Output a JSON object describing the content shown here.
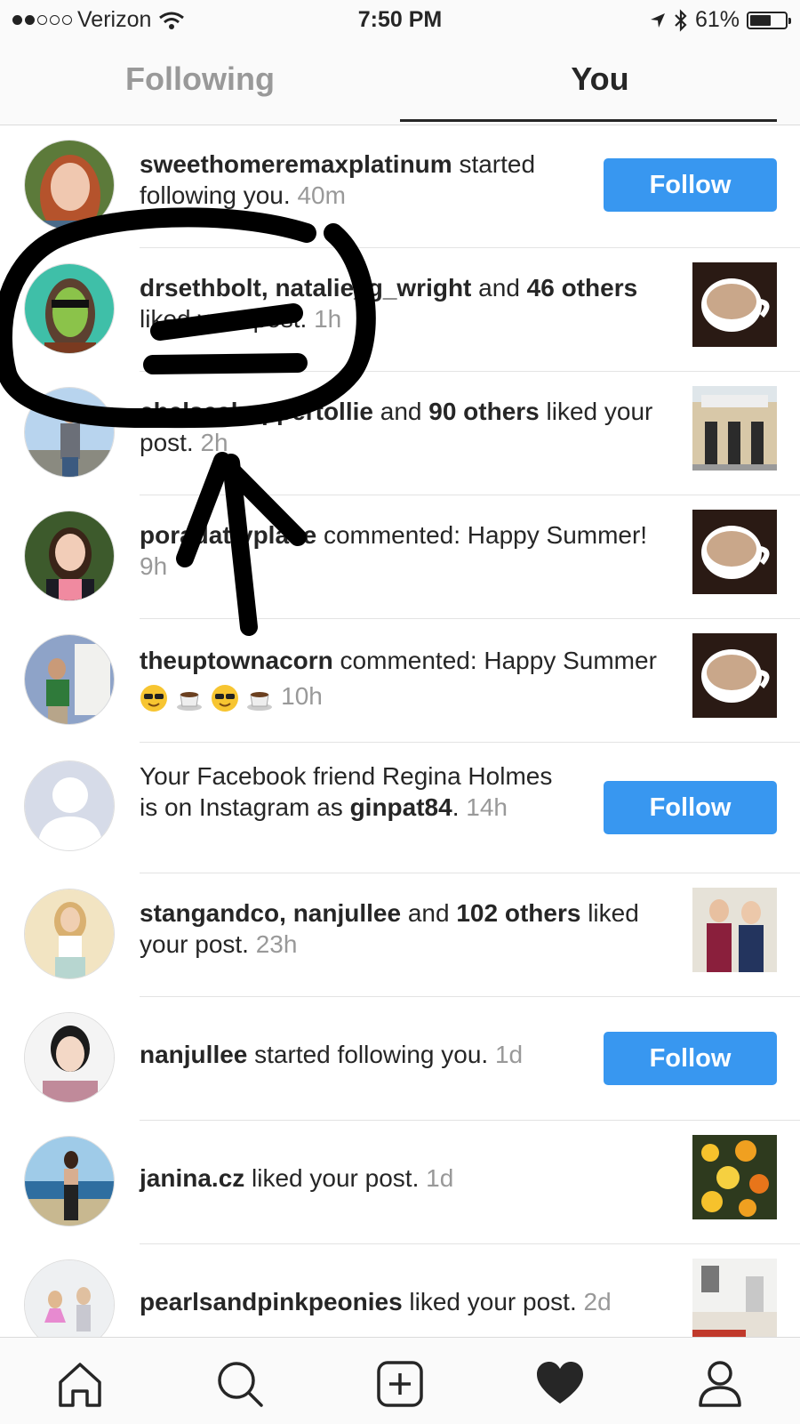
{
  "status_bar": {
    "carrier": "Verizon",
    "time": "7:50 PM",
    "battery": "61%",
    "battery_level": 0.61
  },
  "tabs": [
    {
      "label": "Following",
      "active": false
    },
    {
      "label": "You",
      "active": true
    }
  ],
  "notifications": [
    {
      "user": "sweethomeremaxplatinum",
      "text": " started following you. ",
      "time": "40m",
      "action": "Follow"
    },
    {
      "user": "drsethbolt, natalie_g_wright",
      "mid": " and ",
      "bold2": "46 others",
      "text": " liked your post. ",
      "time": "1h"
    },
    {
      "user": "chelseahoppertollie",
      "mid": " and ",
      "bold2": "90 others",
      "text": " liked your post. ",
      "time": "2h"
    },
    {
      "user": "poradattyplace",
      "text": " commented: Happy Summer! ",
      "time": "9h"
    },
    {
      "user": "theuptownacorn",
      "text": " commented: Happy Summer ",
      "time": "10h"
    },
    {
      "pre": "Your Facebook friend Regina Holmes is on Instagram as ",
      "user": "ginpat84",
      "text": ". ",
      "time": "14h",
      "action": "Follow"
    },
    {
      "user": "stangandco, nanjullee",
      "mid": " and ",
      "bold2": "102 others",
      "text": " liked your post. ",
      "time": "23h"
    },
    {
      "user": "nanjullee",
      "text": " started following you. ",
      "time": "1d",
      "action": "Follow"
    },
    {
      "user": "janina.cz",
      "text": " liked your post. ",
      "time": "1d"
    },
    {
      "user": "pearlsandpinkpeonies",
      "text": " liked your post. ",
      "time": "2d"
    }
  ],
  "bottom_nav": [
    "home-icon",
    "search-icon",
    "add-post-icon",
    "heart-icon",
    "profile-icon"
  ],
  "colors": {
    "follow_button": "#3897f0",
    "timestamp": "#999999",
    "ink": "#000000"
  }
}
